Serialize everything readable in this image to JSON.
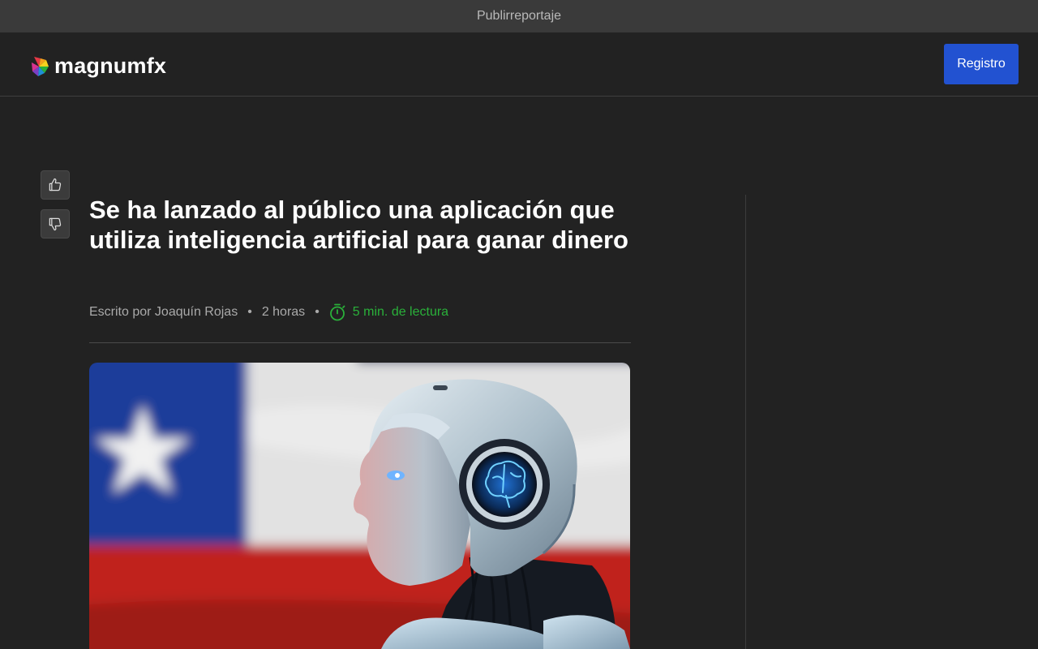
{
  "topbar": {
    "label": "Publirreportaje"
  },
  "header": {
    "logo_text": "magnumfx",
    "register_label": "Registro"
  },
  "article": {
    "title": "Se ha lanzado al público una aplicación que utiliza inteligencia artificial para ganar dinero",
    "author": "Escrito por Joaquín Rojas",
    "separator": "•",
    "time_ago": "2 horas",
    "read_time": "5 min. de lectura"
  },
  "icons": {
    "logo": "colorful-fan-logo-icon",
    "like": "thumbs-up-icon",
    "dislike": "thumbs-down-icon",
    "read_time": "stopwatch-icon"
  },
  "colors": {
    "accent": "#2252d1",
    "read_time": "#2ab03a",
    "background": "#222222",
    "topbar": "#3a3a3a"
  }
}
